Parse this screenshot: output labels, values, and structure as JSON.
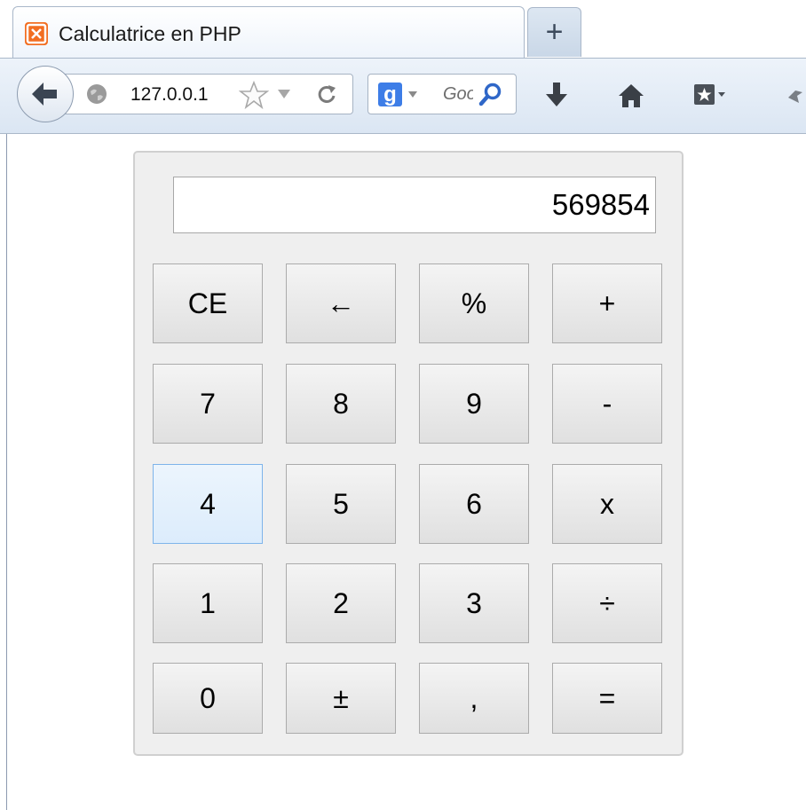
{
  "browser": {
    "tab": {
      "title": "Calculatrice en PHP",
      "favicon": "xampp-icon"
    },
    "new_tab_label": "+",
    "url": "127.0.0.1",
    "search_placeholder": "Google",
    "search_engine_letter": "g",
    "accent_tab_border": "#a9b7c9"
  },
  "calculator": {
    "display_value": "569854",
    "keys": [
      [
        "CE",
        "←",
        "%",
        "+"
      ],
      [
        "7",
        "8",
        "9",
        "-"
      ],
      [
        "4",
        "5",
        "6",
        "x"
      ],
      [
        "1",
        "2",
        "3",
        "÷"
      ],
      [
        "0",
        "±",
        ",",
        "="
      ]
    ],
    "hovered_key": "4",
    "colors": {
      "panel": "#efefef",
      "key": "#e8e8e8",
      "key_hover": "#dcecfc",
      "key_hover_border": "#7eb4ea"
    }
  }
}
